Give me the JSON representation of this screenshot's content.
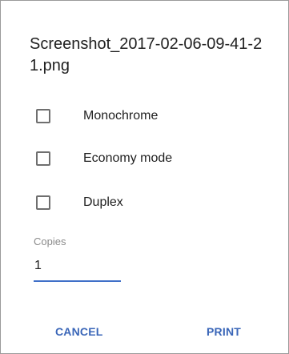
{
  "dialog": {
    "title": "Screenshot_2017-02-06-09-41-21.png",
    "options": [
      {
        "label": "Monochrome",
        "checked": false
      },
      {
        "label": "Economy mode",
        "checked": false
      },
      {
        "label": "Duplex",
        "checked": false
      }
    ],
    "copies": {
      "label": "Copies",
      "value": "1"
    },
    "buttons": {
      "cancel": "CANCEL",
      "print": "PRINT"
    },
    "colors": {
      "accent": "#3a66b8",
      "text": "#212121",
      "hint": "#8a8a8a",
      "checkbox_border": "#6f6f6f"
    }
  }
}
